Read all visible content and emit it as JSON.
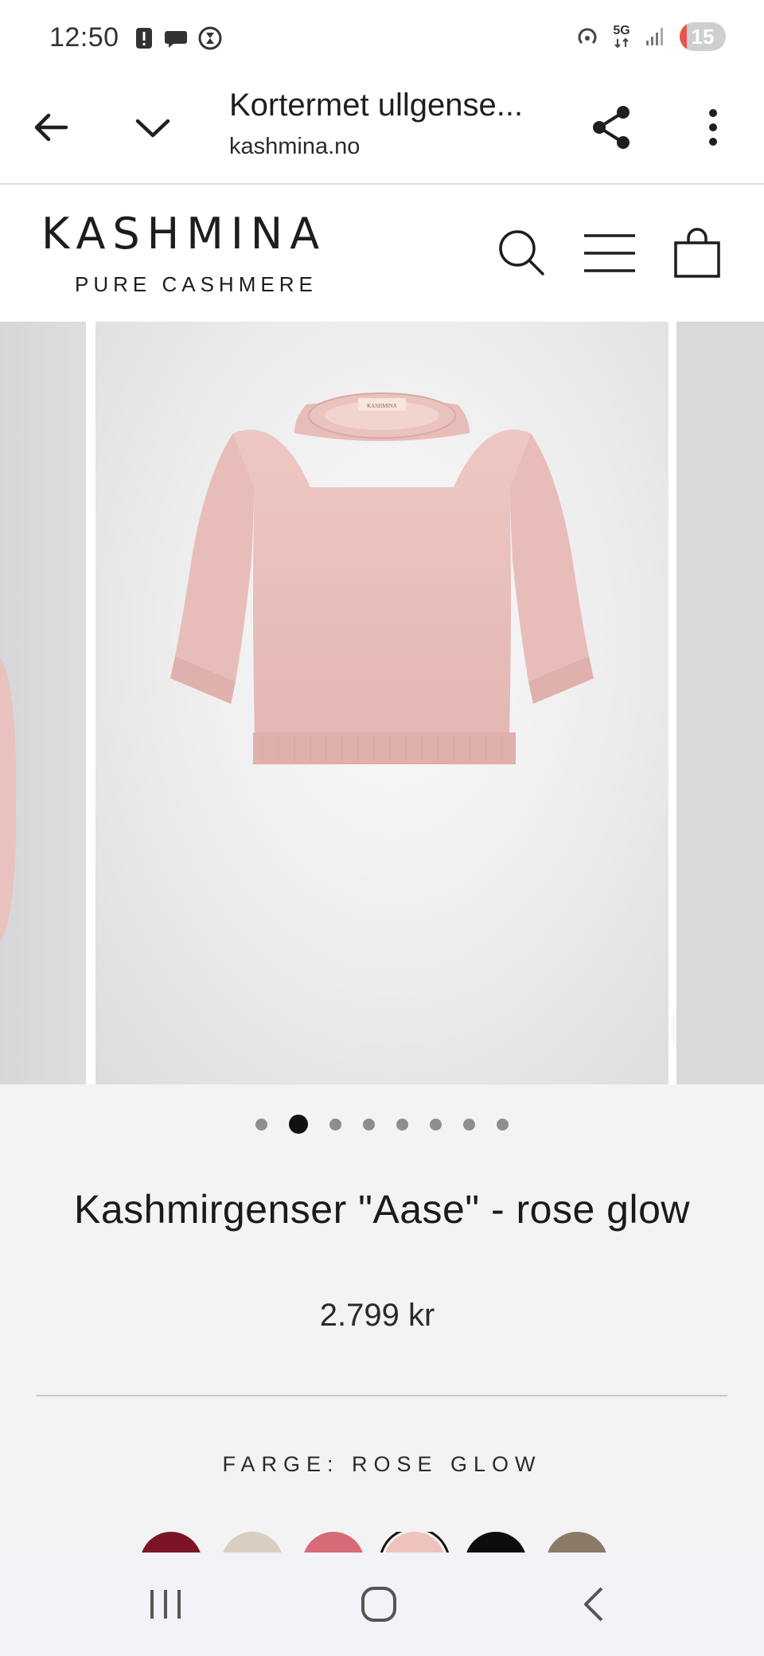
{
  "status_bar": {
    "time": "12:50",
    "network_label": "5G",
    "battery_level": "15",
    "battery_fraction": 0.15
  },
  "browser": {
    "tab_title": "Kortermet ullgense...",
    "url": "kashmina.no"
  },
  "site": {
    "logo_main": "KASHMINA",
    "logo_sub": "PURE CASHMERE"
  },
  "gallery": {
    "dot_count": 8,
    "active_index": 1,
    "product_image_label": "KASHMINA"
  },
  "product": {
    "title": "Kashmirgenser \"Aase\" - rose glow",
    "price": "2.799 kr",
    "color_label": "FARGE: ROSE GLOW"
  },
  "swatches": [
    {
      "color": "#7a1526",
      "selected": false
    },
    {
      "color": "#d9cfc1",
      "selected": false
    },
    {
      "color": "#d86a78",
      "selected": false
    },
    {
      "color": "#eec3bd",
      "selected": true
    },
    {
      "color": "#0d0d0d",
      "selected": false
    },
    {
      "color": "#8b7a68",
      "selected": false
    }
  ],
  "colors": {
    "accent": "#111111",
    "background": "#f3f3f3",
    "sweater": "#e9bfbc"
  }
}
